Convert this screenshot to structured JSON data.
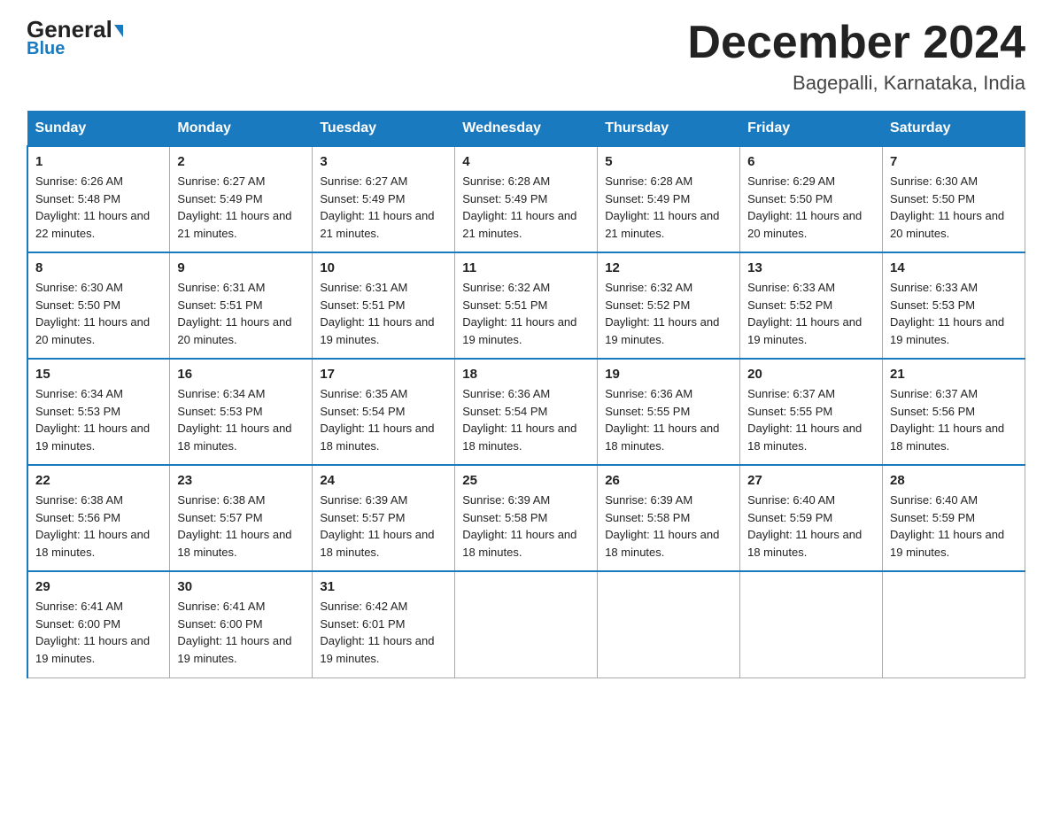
{
  "header": {
    "logo_general": "General",
    "logo_blue": "Blue",
    "month_title": "December 2024",
    "subtitle": "Bagepalli, Karnataka, India"
  },
  "weekdays": [
    "Sunday",
    "Monday",
    "Tuesday",
    "Wednesday",
    "Thursday",
    "Friday",
    "Saturday"
  ],
  "weeks": [
    [
      {
        "day": "1",
        "sunrise": "6:26 AM",
        "sunset": "5:48 PM",
        "daylight": "11 hours and 22 minutes."
      },
      {
        "day": "2",
        "sunrise": "6:27 AM",
        "sunset": "5:49 PM",
        "daylight": "11 hours and 21 minutes."
      },
      {
        "day": "3",
        "sunrise": "6:27 AM",
        "sunset": "5:49 PM",
        "daylight": "11 hours and 21 minutes."
      },
      {
        "day": "4",
        "sunrise": "6:28 AM",
        "sunset": "5:49 PM",
        "daylight": "11 hours and 21 minutes."
      },
      {
        "day": "5",
        "sunrise": "6:28 AM",
        "sunset": "5:49 PM",
        "daylight": "11 hours and 21 minutes."
      },
      {
        "day": "6",
        "sunrise": "6:29 AM",
        "sunset": "5:50 PM",
        "daylight": "11 hours and 20 minutes."
      },
      {
        "day": "7",
        "sunrise": "6:30 AM",
        "sunset": "5:50 PM",
        "daylight": "11 hours and 20 minutes."
      }
    ],
    [
      {
        "day": "8",
        "sunrise": "6:30 AM",
        "sunset": "5:50 PM",
        "daylight": "11 hours and 20 minutes."
      },
      {
        "day": "9",
        "sunrise": "6:31 AM",
        "sunset": "5:51 PM",
        "daylight": "11 hours and 20 minutes."
      },
      {
        "day": "10",
        "sunrise": "6:31 AM",
        "sunset": "5:51 PM",
        "daylight": "11 hours and 19 minutes."
      },
      {
        "day": "11",
        "sunrise": "6:32 AM",
        "sunset": "5:51 PM",
        "daylight": "11 hours and 19 minutes."
      },
      {
        "day": "12",
        "sunrise": "6:32 AM",
        "sunset": "5:52 PM",
        "daylight": "11 hours and 19 minutes."
      },
      {
        "day": "13",
        "sunrise": "6:33 AM",
        "sunset": "5:52 PM",
        "daylight": "11 hours and 19 minutes."
      },
      {
        "day": "14",
        "sunrise": "6:33 AM",
        "sunset": "5:53 PM",
        "daylight": "11 hours and 19 minutes."
      }
    ],
    [
      {
        "day": "15",
        "sunrise": "6:34 AM",
        "sunset": "5:53 PM",
        "daylight": "11 hours and 19 minutes."
      },
      {
        "day": "16",
        "sunrise": "6:34 AM",
        "sunset": "5:53 PM",
        "daylight": "11 hours and 18 minutes."
      },
      {
        "day": "17",
        "sunrise": "6:35 AM",
        "sunset": "5:54 PM",
        "daylight": "11 hours and 18 minutes."
      },
      {
        "day": "18",
        "sunrise": "6:36 AM",
        "sunset": "5:54 PM",
        "daylight": "11 hours and 18 minutes."
      },
      {
        "day": "19",
        "sunrise": "6:36 AM",
        "sunset": "5:55 PM",
        "daylight": "11 hours and 18 minutes."
      },
      {
        "day": "20",
        "sunrise": "6:37 AM",
        "sunset": "5:55 PM",
        "daylight": "11 hours and 18 minutes."
      },
      {
        "day": "21",
        "sunrise": "6:37 AM",
        "sunset": "5:56 PM",
        "daylight": "11 hours and 18 minutes."
      }
    ],
    [
      {
        "day": "22",
        "sunrise": "6:38 AM",
        "sunset": "5:56 PM",
        "daylight": "11 hours and 18 minutes."
      },
      {
        "day": "23",
        "sunrise": "6:38 AM",
        "sunset": "5:57 PM",
        "daylight": "11 hours and 18 minutes."
      },
      {
        "day": "24",
        "sunrise": "6:39 AM",
        "sunset": "5:57 PM",
        "daylight": "11 hours and 18 minutes."
      },
      {
        "day": "25",
        "sunrise": "6:39 AM",
        "sunset": "5:58 PM",
        "daylight": "11 hours and 18 minutes."
      },
      {
        "day": "26",
        "sunrise": "6:39 AM",
        "sunset": "5:58 PM",
        "daylight": "11 hours and 18 minutes."
      },
      {
        "day": "27",
        "sunrise": "6:40 AM",
        "sunset": "5:59 PM",
        "daylight": "11 hours and 18 minutes."
      },
      {
        "day": "28",
        "sunrise": "6:40 AM",
        "sunset": "5:59 PM",
        "daylight": "11 hours and 19 minutes."
      }
    ],
    [
      {
        "day": "29",
        "sunrise": "6:41 AM",
        "sunset": "6:00 PM",
        "daylight": "11 hours and 19 minutes."
      },
      {
        "day": "30",
        "sunrise": "6:41 AM",
        "sunset": "6:00 PM",
        "daylight": "11 hours and 19 minutes."
      },
      {
        "day": "31",
        "sunrise": "6:42 AM",
        "sunset": "6:01 PM",
        "daylight": "11 hours and 19 minutes."
      },
      null,
      null,
      null,
      null
    ]
  ]
}
